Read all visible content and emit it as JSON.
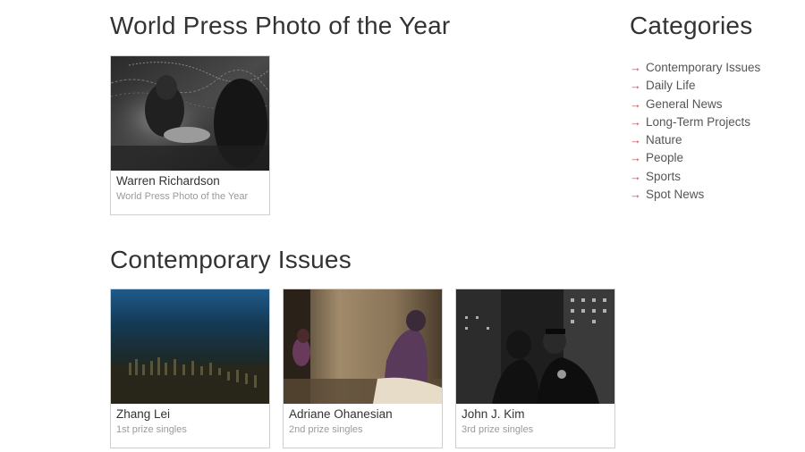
{
  "poty": {
    "title": "World Press Photo of the Year",
    "card": {
      "name": "Warren Richardson",
      "sub": "World Press Photo of the Year"
    }
  },
  "contemporary": {
    "title": "Contemporary Issues",
    "cards": [
      {
        "name": "Zhang Lei",
        "sub": "1st prize singles"
      },
      {
        "name": "Adriane Ohanesian",
        "sub": "2nd prize singles"
      },
      {
        "name": "John J. Kim",
        "sub": "3rd prize singles"
      }
    ]
  },
  "categories": {
    "title": "Categories",
    "arrow_glyph": "→",
    "items": [
      "Contemporary Issues",
      "Daily Life",
      "General News",
      "Long-Term Projects",
      "Nature",
      "People",
      "Sports",
      "Spot News"
    ]
  },
  "colors": {
    "accent_arrow": "#c8464f",
    "card_border": "#cfcfcf",
    "subtext": "#9a9a9a"
  }
}
